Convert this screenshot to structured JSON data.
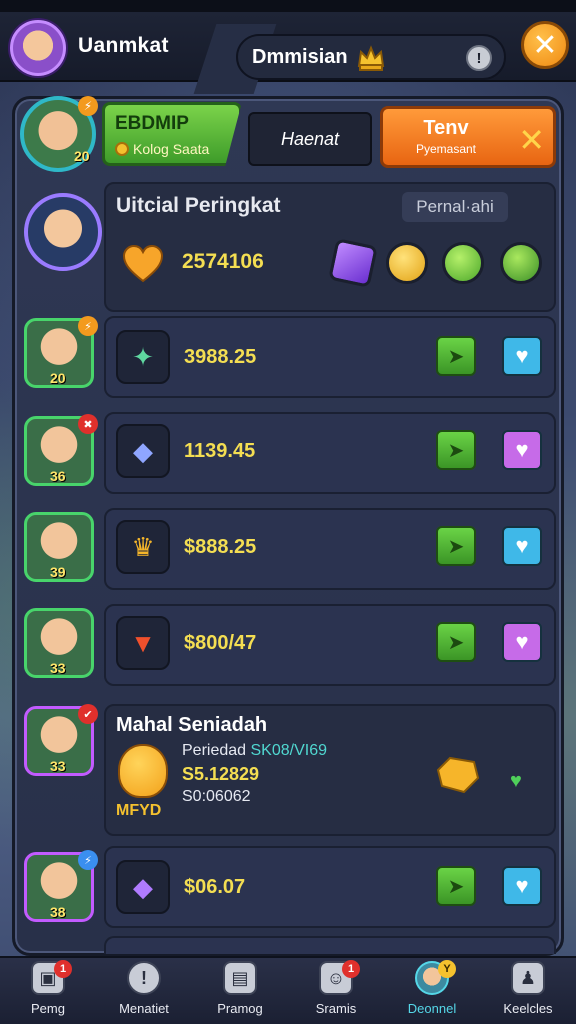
{
  "top": {
    "title": "Uanmkat",
    "pill_title": "Dmmisian",
    "info": "!",
    "close": "✕"
  },
  "header": {
    "level_badge": "⚡",
    "green_title": "EBDMIP",
    "green_sub": "Kolog Saata",
    "avatar_level": "20",
    "dark_label": "Haenat",
    "orange_title": "Tenv",
    "orange_sub": "Pyemasant",
    "orange_icon": "✕"
  },
  "section1": {
    "title": "Uitcial Peringkat",
    "tag": "Pernal·ahi",
    "score": "2574106",
    "rewards": [
      "purple-gem-icon",
      "gold-coin-icon",
      "green-swirl-icon",
      "green-orb-icon"
    ]
  },
  "rows": [
    {
      "level": "20",
      "item": "green-leaf-icon",
      "value": "3988.25",
      "heart_color": "#3fb8e8"
    },
    {
      "level": "36",
      "item": "blue-crystal-icon",
      "value": "1139.45",
      "heart_color": "#c66be8"
    },
    {
      "level": "39",
      "item": "gold-chest-icon",
      "value": "$888.25",
      "heart_color": "#3fb8e8"
    },
    {
      "level": "33",
      "item": "red-carrot-icon",
      "value": "$800/47",
      "heart_color": "#c66be8"
    }
  ],
  "special": {
    "title": "Mahal Seniadah",
    "line1_prefix": "Periedad",
    "line1_hl": "SK08/​VI69",
    "line2": "S5.12829",
    "line3": "S0:06062",
    "footer": "MFYD",
    "avatar_level": "33"
  },
  "last_row": {
    "level": "38",
    "value": "$06.07"
  },
  "nav": [
    {
      "label": "Pemg",
      "icon": "bag-icon",
      "badge": "1"
    },
    {
      "label": "Menatiet",
      "icon": "clock-icon",
      "badge": ""
    },
    {
      "label": "Pramog",
      "icon": "film-icon",
      "badge": ""
    },
    {
      "label": "Sramis",
      "icon": "ghost-icon",
      "badge": "1"
    },
    {
      "label": "Deonnel",
      "icon": "hero-icon",
      "badge": "Y"
    },
    {
      "label": "Keelcles",
      "icon": "person-icon",
      "badge": ""
    }
  ]
}
